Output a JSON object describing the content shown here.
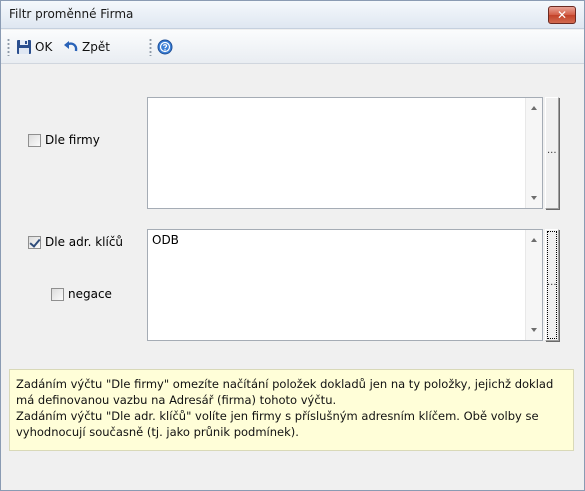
{
  "window": {
    "title": "Filtr proměnné Firma",
    "close_glyph": "✕"
  },
  "toolbar": {
    "ok_label": "OK",
    "back_label": "Zpět",
    "ok_icon": "save-icon",
    "back_icon": "undo-icon",
    "help_icon": "help-icon"
  },
  "filters": {
    "by_company": {
      "label": "Dle firmy",
      "checked": false,
      "value": ""
    },
    "by_keys": {
      "label": "Dle adr. klíčů",
      "checked": true,
      "value": "ODB"
    },
    "negation": {
      "label": "negace",
      "checked": false
    },
    "ellipsis": "..."
  },
  "info": {
    "line1": "Zadáním výčtu \"Dle firmy\" omezíte načítání položek dokladů jen na ty položky, jejichž doklad má definovanou vazbu na Adresář (firma) tohoto výčtu.",
    "line2": "Zadáním výčtu \"Dle adr. klíčů\" volíte jen firmy s příslušným adresním klíčem. Obě volby se vyhodnocují současně (tj. jako průnik podmínek)."
  },
  "colors": {
    "info_bg": "#fffed8",
    "close_red": "#c24229"
  }
}
